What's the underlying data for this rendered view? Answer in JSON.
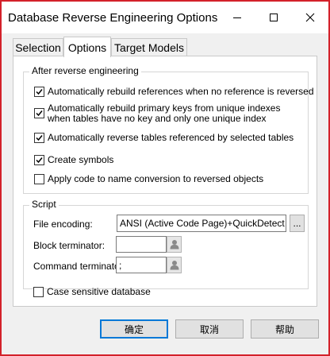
{
  "window": {
    "title": "Database Reverse Engineering Options",
    "accent_border": "#d3212a"
  },
  "tabs": [
    {
      "label": "Selection",
      "active": false
    },
    {
      "label": "Options",
      "active": true
    },
    {
      "label": "Target Models",
      "active": false
    }
  ],
  "after_reverse": {
    "title": "After reverse engineering",
    "options": [
      {
        "label": "Automatically rebuild references when no reference is reversed",
        "checked": true
      },
      {
        "label": "Automatically rebuild primary keys from unique indexes when tables have no key and only one unique index",
        "checked": true
      },
      {
        "label": "Automatically reverse tables referenced by selected tables",
        "checked": true
      },
      {
        "label": "Create symbols",
        "checked": true
      },
      {
        "label": "Apply code to name conversion to reversed objects",
        "checked": false
      }
    ]
  },
  "script": {
    "title": "Script",
    "file_encoding_label": "File encoding:",
    "file_encoding_value": "ANSI (Active Code Page)+QuickDetect",
    "browse_label": "...",
    "block_terminator_label": "Block terminator:",
    "block_terminator_value": "",
    "command_terminator_label": "Command terminator:",
    "command_terminator_value": ";"
  },
  "case_sensitive": {
    "label": "Case sensitive database",
    "checked": false
  },
  "buttons": {
    "ok": "确定",
    "cancel": "取消",
    "help": "帮助",
    "default_color": "#0078d7"
  }
}
